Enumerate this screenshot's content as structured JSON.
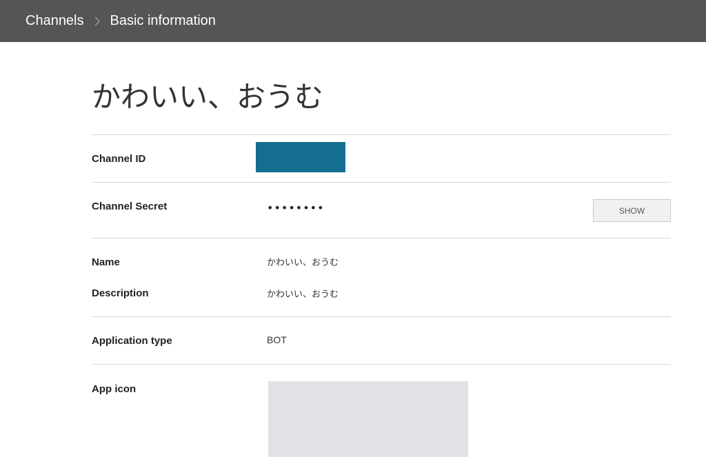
{
  "breadcrumb": {
    "parent": "Channels",
    "current": "Basic information"
  },
  "page": {
    "title": "かわいい、おうむ"
  },
  "fields": {
    "channel_id": {
      "label": "Channel ID"
    },
    "channel_secret": {
      "label": "Channel Secret",
      "value": "••••••••",
      "show_button": "SHOW"
    },
    "name": {
      "label": "Name",
      "value": "かわいい、おうむ"
    },
    "description": {
      "label": "Description",
      "value": "かわいい、おうむ"
    },
    "application_type": {
      "label": "Application type",
      "value": "BOT"
    },
    "app_icon": {
      "label": "App icon"
    }
  },
  "colors": {
    "topbar": "#555555",
    "id_mask": "#146e90",
    "icon_placeholder": "#e1e2e5"
  },
  "icons": {
    "breadcrumb_separator": "chevron-right-icon"
  }
}
